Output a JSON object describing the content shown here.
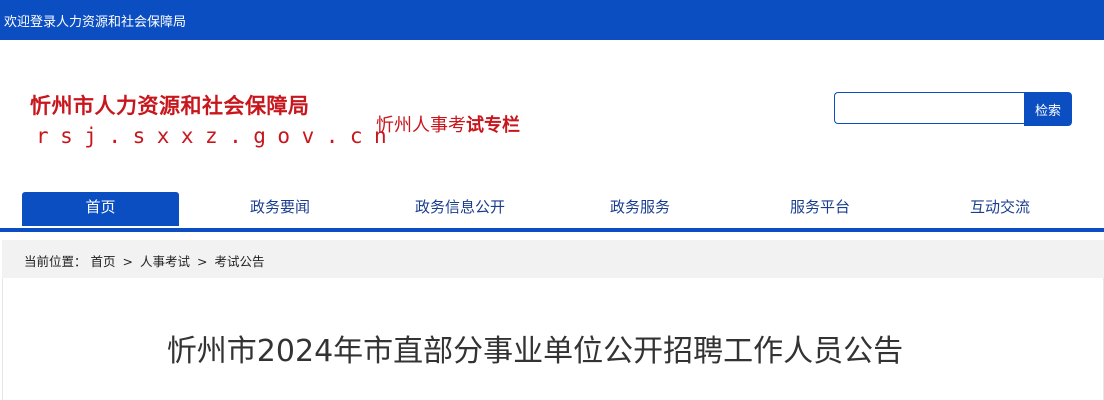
{
  "topbar": {
    "welcome": "欢迎登录人力资源和社会保障局"
  },
  "header": {
    "site_name": "忻州市人力资源和社会保障局",
    "domain": "rsj.sxxz.gov.cn",
    "column_title_normal": "忻州人事考",
    "column_title_bold": "试专栏"
  },
  "search": {
    "value": "",
    "button_label": "检索"
  },
  "nav": {
    "items": [
      {
        "label": "首页"
      },
      {
        "label": "政务要闻"
      },
      {
        "label": "政务信息公开"
      },
      {
        "label": "政务服务"
      },
      {
        "label": "服务平台"
      },
      {
        "label": "互动交流"
      }
    ]
  },
  "breadcrumb": {
    "prefix": "当前位置：",
    "items": [
      "首页",
      "人事考试",
      "考试公告"
    ],
    "separator": ">"
  },
  "article": {
    "title": "忻州市2024年市直部分事业单位公开招聘工作人员公告"
  },
  "colors": {
    "brand_blue": "#0b4ec2",
    "brand_red": "#c8161d"
  }
}
